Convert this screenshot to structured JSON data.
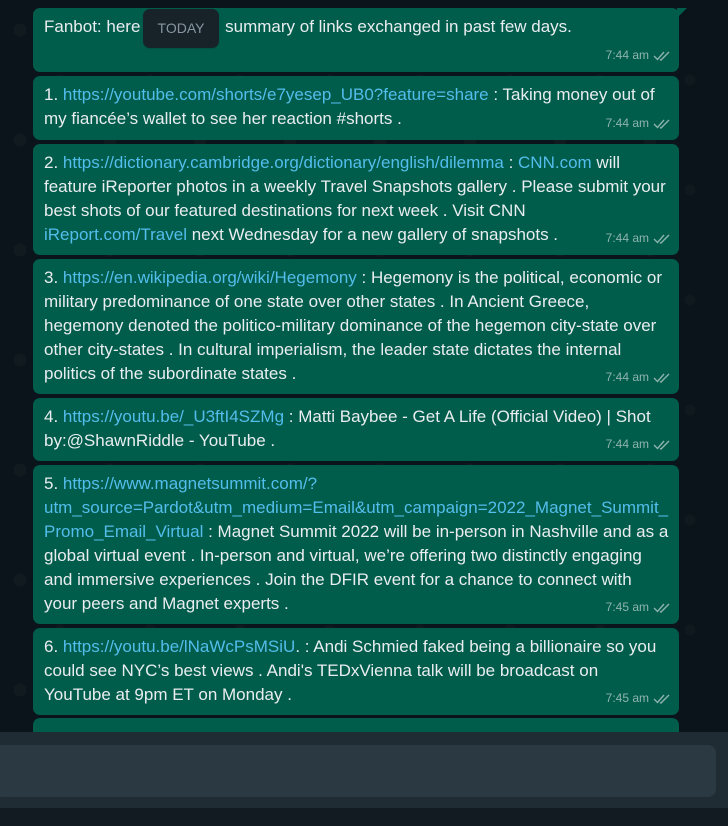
{
  "date_chip": "TODAY",
  "messages": [
    {
      "before": "Fanbot: here",
      "after": " summary of links exchanged in past few days.",
      "time": "7:44 am"
    },
    {
      "prefix": "1. ",
      "link": "https://youtube.com/shorts/e7yesep_UB0?feature=share",
      "body": " :  Taking money out of my fiancée’s wallet to see her reaction #shorts .",
      "time": "7:44 am"
    },
    {
      "prefix": "2. ",
      "link": "https://dictionary.cambridge.org/dictionary/english/dilemma",
      "mid": " :  ",
      "link2": "CNN.com",
      "body": " will feature iReporter photos in a weekly Travel Snapshots gallery . Please submit your best shots of our featured destinations for next week . Visit CNN ",
      "link3": "iReport.com/Travel",
      "body2": " next Wednesday for a new gallery of snapshots .",
      "time": "7:44 am"
    },
    {
      "prefix": "3. ",
      "link": "https://en.wikipedia.org/wiki/Hegemony",
      "body": " :  Hegemony is the political, economic or military predominance of one state over other states . In Ancient Greece, hegemony denoted the politico-military dominance of the hegemon city-state over other city-states . In cultural imperialism, the leader state dictates the internal politics of the subordinate states .",
      "time": "7:44 am"
    },
    {
      "prefix": "4. ",
      "link": "https://youtu.be/_U3ftI4SZMg",
      "body": " :  Matti Baybee - Get A Life (Official Video) | Shot by:@ShawnRiddle - YouTube .",
      "time": "7:44 am"
    },
    {
      "prefix": "5. ",
      "link": "https://www.magnetsummit.com/?utm_source=Pardot&utm_medium=Email&utm_campaign=2022_Magnet_Summit_Promo_Email_Virtual",
      "body": " :  Magnet Summit 2022 will be in-person in Nashville and as a global virtual event . In-person and virtual, we’re offering two distinctly engaging and immersive experiences . Join the DFIR event for a chance to connect with your peers and Magnet experts .",
      "time": "7:45 am"
    },
    {
      "prefix": "6. ",
      "link": "https://youtu.be/lNaWcPsMSiU",
      "body": ". :  Andi Schmied faked being a billionaire so you could see NYC’s best views . Andi's TEDxVienna talk will be broadcast on YouTube at 9pm ET on Monday .",
      "time": "7:45 am"
    }
  ],
  "colors": {
    "bubble": "#005c4b",
    "link": "#53bdeb",
    "background": "#0b141a"
  },
  "icons": {
    "delivered": "double-check-icon"
  }
}
